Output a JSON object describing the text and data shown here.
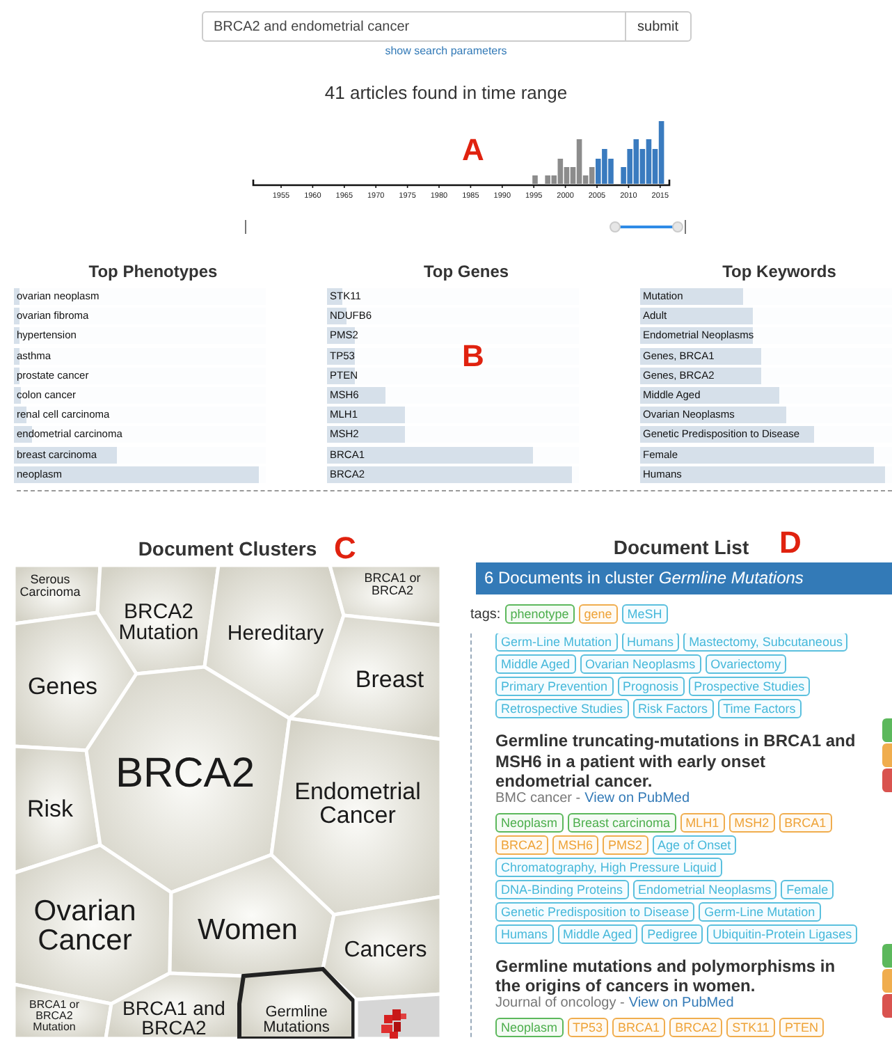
{
  "search": {
    "value": "BRCA2 and endometrial cancer",
    "submit": "submit",
    "params_link": "show search parameters"
  },
  "timeline": {
    "title": "41 articles found in time range",
    "year_labels": [
      "1955",
      "1960",
      "1965",
      "1970",
      "1975",
      "1980",
      "1985",
      "1990",
      "1995",
      "2000",
      "2005",
      "2010",
      "2015"
    ],
    "range_slider": {
      "start": {
        "level": 0.84
      },
      "end": {
        "level": 0.985
      }
    }
  },
  "top_lists": [
    {
      "title": "Top Phenotypes",
      "items": [
        {
          "label": "ovarian neoplasm",
          "level": 0.02
        },
        {
          "label": "ovarian fibroma",
          "level": 0.02
        },
        {
          "label": "hypertension",
          "level": 0.02
        },
        {
          "label": "asthma",
          "level": 0.02
        },
        {
          "label": "prostate cancer",
          "level": 0.02
        },
        {
          "label": "colon cancer",
          "level": 0.03
        },
        {
          "label": "renal cell carcinoma",
          "level": 0.05
        },
        {
          "label": "endometrial carcinoma",
          "level": 0.07
        },
        {
          "label": "breast carcinoma",
          "level": 0.41
        },
        {
          "label": "neoplasm",
          "level": 0.97
        }
      ]
    },
    {
      "title": "Top Genes",
      "items": [
        {
          "label": "STK11",
          "level": 0.06
        },
        {
          "label": "NDUFB6",
          "level": 0.08
        },
        {
          "label": "PMS2",
          "level": 0.11
        },
        {
          "label": "TP53",
          "level": 0.11
        },
        {
          "label": "PTEN",
          "level": 0.11
        },
        {
          "label": "MSH6",
          "level": 0.23
        },
        {
          "label": "MLH1",
          "level": 0.31
        },
        {
          "label": "MSH2",
          "level": 0.31
        },
        {
          "label": "BRCA1",
          "level": 0.82
        },
        {
          "label": "BRCA2",
          "level": 0.97
        }
      ]
    },
    {
      "title": "Top Keywords",
      "items": [
        {
          "label": "Mutation",
          "level": 0.41
        },
        {
          "label": "Adult",
          "level": 0.45
        },
        {
          "label": "Endometrial Neoplasms",
          "level": 0.45
        },
        {
          "label": "Genes, BRCA1",
          "level": 0.48
        },
        {
          "label": "Genes, BRCA2",
          "level": 0.48
        },
        {
          "label": "Middle Aged",
          "level": 0.55
        },
        {
          "label": "Ovarian Neoplasms",
          "level": 0.58
        },
        {
          "label": "Genetic Predisposition to Disease",
          "level": 0.69
        },
        {
          "label": "Female",
          "level": 0.93
        },
        {
          "label": "Humans",
          "level": 0.97
        }
      ]
    }
  ],
  "annotations": [
    {
      "label": "A"
    },
    {
      "label": "B"
    },
    {
      "label": "C"
    },
    {
      "label": "D"
    }
  ],
  "clusters": {
    "title": "Document Clusters",
    "cells": [
      {
        "label": "Serous Carcinoma",
        "selected": false
      },
      {
        "label": "BRCA2 Mutation",
        "selected": false
      },
      {
        "label": "Hereditary",
        "selected": false
      },
      {
        "label": "BRCA1 or BRCA2",
        "selected": false
      },
      {
        "label": "Genes",
        "selected": false
      },
      {
        "label": "Breast",
        "selected": false
      },
      {
        "label": "Risk",
        "selected": false
      },
      {
        "label": "BRCA2",
        "selected": false
      },
      {
        "label": "Endometrial Cancer",
        "selected": false
      },
      {
        "label": "Ovarian Cancer",
        "selected": false
      },
      {
        "label": "Women",
        "selected": false
      },
      {
        "label": "Cancers",
        "selected": false
      },
      {
        "label": "BRCA1 or BRCA2 Mutation",
        "selected": false
      },
      {
        "label": "BRCA1 and BRCA2",
        "selected": false
      },
      {
        "label": "Germline Mutations",
        "selected": true
      },
      {
        "kind": "picture",
        "selected": false
      }
    ]
  },
  "document_list": {
    "title": "Document List",
    "header": "6 Documents in cluster *Germline Mutations*",
    "legend_label": "tags:",
    "legend": [
      {
        "label": "phenotype",
        "kind": "phenotype"
      },
      {
        "label": "gene",
        "kind": "gene"
      },
      {
        "label": "MeSH",
        "kind": "mesh"
      }
    ],
    "documents": [
      {
        "tag_lines": [
          [
            {
              "label": "Germ-Line Mutation",
              "kind": "mesh"
            },
            {
              "label": "Humans",
              "kind": "mesh"
            },
            {
              "label": "Mastectomy, Subcutaneous",
              "kind": "mesh"
            }
          ],
          [
            {
              "label": "Middle Aged",
              "kind": "mesh"
            },
            {
              "label": "Ovarian Neoplasms",
              "kind": "mesh"
            },
            {
              "label": "Ovariectomy",
              "kind": "mesh"
            }
          ],
          [
            {
              "label": "Primary Prevention",
              "kind": "mesh"
            },
            {
              "label": "Prognosis",
              "kind": "mesh"
            },
            {
              "label": "Prospective Studies",
              "kind": "mesh"
            }
          ],
          [
            {
              "label": "Retrospective Studies",
              "kind": "mesh"
            },
            {
              "label": "Risk Factors",
              "kind": "mesh"
            },
            {
              "label": "Time Factors",
              "kind": "mesh"
            }
          ]
        ]
      },
      {
        "title": "Germline truncating-mutations in BRCA1 and MSH6 in a patient with early onset endometrial cancer.",
        "journal": "BMC cancer -",
        "link": "View on PubMed",
        "feedback": [
          {
            "color": "#5cb85c"
          },
          {
            "color": "#f0ad4e"
          },
          {
            "color": "#d9534f"
          }
        ],
        "tag_lines": [
          [
            {
              "label": "Neoplasm",
              "kind": "phenotype"
            },
            {
              "label": "Breast carcinoma",
              "kind": "phenotype"
            },
            {
              "label": "MLH1",
              "kind": "gene"
            },
            {
              "label": "MSH2",
              "kind": "gene"
            },
            {
              "label": "BRCA1",
              "kind": "gene"
            }
          ],
          [
            {
              "label": "BRCA2",
              "kind": "gene"
            },
            {
              "label": "MSH6",
              "kind": "gene"
            },
            {
              "label": "PMS2",
              "kind": "gene"
            },
            {
              "label": "Age of Onset",
              "kind": "mesh"
            }
          ],
          [
            {
              "label": "Chromatography, High Pressure Liquid",
              "kind": "mesh"
            }
          ],
          [
            {
              "label": "DNA-Binding Proteins",
              "kind": "mesh"
            },
            {
              "label": "Endometrial Neoplasms",
              "kind": "mesh"
            },
            {
              "label": "Female",
              "kind": "mesh"
            }
          ],
          [
            {
              "label": "Genetic Predisposition to Disease",
              "kind": "mesh"
            },
            {
              "label": "Germ-Line Mutation",
              "kind": "mesh"
            }
          ],
          [
            {
              "label": "Humans",
              "kind": "mesh"
            },
            {
              "label": "Middle Aged",
              "kind": "mesh"
            },
            {
              "label": "Pedigree",
              "kind": "mesh"
            },
            {
              "label": "Ubiquitin-Protein Ligases",
              "kind": "mesh"
            }
          ]
        ]
      },
      {
        "title": "Germline mutations and polymorphisms in the origins of cancers in women.",
        "journal": "Journal of oncology -",
        "link": "View on PubMed",
        "feedback": [
          {
            "color": "#5cb85c"
          },
          {
            "color": "#f0ad4e"
          },
          {
            "color": "#d9534f"
          }
        ],
        "tag_lines": [
          [
            {
              "label": "Neoplasm",
              "kind": "phenotype"
            },
            {
              "label": "TP53",
              "kind": "gene"
            },
            {
              "label": "BRCA1",
              "kind": "gene"
            },
            {
              "label": "BRCA2",
              "kind": "gene"
            },
            {
              "label": "STK11",
              "kind": "gene"
            },
            {
              "label": "PTEN",
              "kind": "gene"
            }
          ]
        ]
      }
    ]
  }
}
